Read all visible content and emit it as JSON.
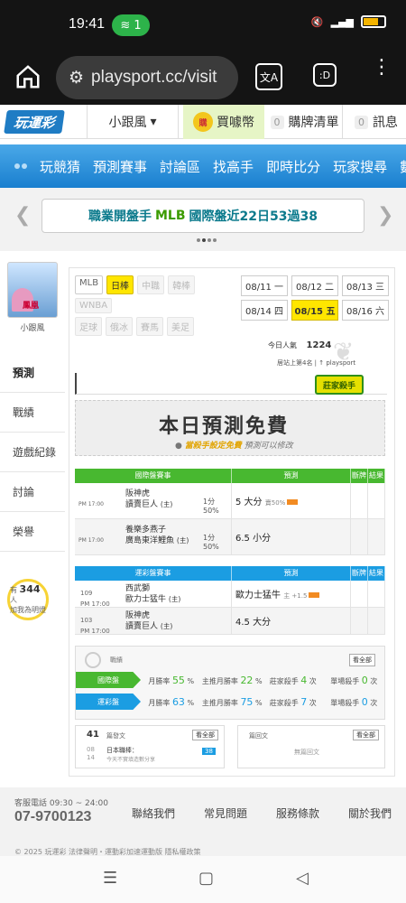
{
  "status": {
    "time": "19:41",
    "notif_count": "1"
  },
  "browser": {
    "url": "playsport.cc/visit",
    "tabs_label": ":D"
  },
  "topnav": {
    "logo": "玩運彩",
    "user": "小跟風",
    "buy_coin_badge": "購",
    "buy": "買噱幣",
    "cart_count": "0",
    "cart": "購牌清單",
    "msg_count": "0",
    "msg": "訊息"
  },
  "bluenav": {
    "items": [
      "玩競猜",
      "預測賽事",
      "討論區",
      "找高手",
      "即時比分",
      "玩家搜尋",
      "數據"
    ]
  },
  "banner": {
    "prefix": "職業開盤手",
    "highlight": "MLB",
    "suffix": "國際盤近22日53過38"
  },
  "sidebar": {
    "avatar_text": "鳳凰",
    "username": "小跟風",
    "menu": [
      "預測",
      "戰績",
      "遊戲紀錄",
      "討論",
      "榮譽"
    ],
    "tracking_prefix": "有",
    "tracking_count": "344",
    "tracking_unit": "人",
    "tracking_suffix": "加我為明燈"
  },
  "leagues": {
    "row1": [
      {
        "label": "MLB",
        "state": "normal"
      },
      {
        "label": "日棒",
        "state": "active"
      },
      {
        "label": "中職",
        "state": "dim"
      },
      {
        "label": "韓棒",
        "state": "dim"
      }
    ],
    "row2": [
      {
        "label": "WNBA",
        "state": "dim"
      }
    ],
    "row3": [
      {
        "label": "足球",
        "state": "dim"
      },
      {
        "label": "俄冰",
        "state": "dim"
      },
      {
        "label": "賽馬",
        "state": "dim"
      },
      {
        "label": "美足",
        "state": "dim"
      }
    ]
  },
  "dates": [
    {
      "date": "08/11",
      "day": "一"
    },
    {
      "date": "08/12",
      "day": "二"
    },
    {
      "date": "08/13",
      "day": "三"
    },
    {
      "date": "08/14",
      "day": "四"
    },
    {
      "date": "08/15",
      "day": "五",
      "active": true
    },
    {
      "date": "08/16",
      "day": "六"
    }
  ],
  "stats": {
    "popular_label": "今日人氣",
    "popular_value": "1224",
    "rank": "居站上第4名 | ↑ playsport",
    "badge": "莊家殺手",
    "badge_sub": "日本國際盤"
  },
  "free": {
    "title": "本日預測免費",
    "note_bold": "當殺手設定免費",
    "note": "預測可以修改"
  },
  "table1": {
    "headers": [
      "國際盤賽事",
      "預測",
      "斷牌",
      "結果"
    ],
    "rows": [
      {
        "time": "PM 17:00",
        "team1": "阪神虎",
        "team2": "讀賣巨人",
        "team2_tag": "(主)",
        "line": "1分",
        "line_pct": "50%",
        "pick": "5 大分",
        "pick_note": "賣50%"
      },
      {
        "time": "PM 17:00",
        "team1": "養樂多燕子",
        "team2": "廣島東洋鯉魚",
        "team2_tag": "(主)",
        "line": "1分",
        "line_pct": "50%",
        "pick": "6.5 小分",
        "pick_note": ""
      }
    ]
  },
  "table2": {
    "headers": [
      "運彩盤賽事",
      "預測",
      "斷牌",
      "結果"
    ],
    "rows": [
      {
        "num": "109",
        "time": "PM 17:00",
        "team1": "西武獅",
        "team2": "歐力士猛牛",
        "team2_tag": "(主)",
        "pick": "歐力士猛牛",
        "pick_note": "主 +1.5"
      },
      {
        "num": "103",
        "time": "PM 17:00",
        "team1": "阪神虎",
        "team2": "讀賣巨人",
        "team2_tag": "(主)",
        "pick": "4.5 大分",
        "pick_note": ""
      }
    ]
  },
  "record": {
    "label": "戰績",
    "view_all": "看全部",
    "rows": [
      {
        "name": "國際盤",
        "color": "#48b830",
        "cells": [
          {
            "label": "月勝率",
            "value": "55",
            "unit": "%"
          },
          {
            "label": "主推月勝率",
            "value": "22",
            "unit": "%"
          },
          {
            "label": "莊家殺手",
            "value": "4",
            "unit": "次"
          },
          {
            "label": "單場殺手",
            "value": "0",
            "unit": "次"
          }
        ]
      },
      {
        "name": "運彩盤",
        "color": "#1b9de2",
        "cells": [
          {
            "label": "月勝率",
            "value": "63",
            "unit": "%"
          },
          {
            "label": "主推月勝率",
            "value": "75",
            "unit": "%"
          },
          {
            "label": "莊家殺手",
            "value": "7",
            "unit": "次"
          },
          {
            "label": "單場殺手",
            "value": "0",
            "unit": "次"
          }
        ]
      }
    ]
  },
  "posts": {
    "count": "41",
    "label": "篇發文",
    "view_all": "看全部",
    "date_m": "08",
    "date_d": "14",
    "title": "日本職棒：",
    "snippet": "今天不實填造數分享",
    "views": "38"
  },
  "replies": {
    "label": "篇回文",
    "view_all": "看全部",
    "empty": "無篇回文"
  },
  "footer": {
    "service": "客服電話 09:30 ~ 24:00",
    "phone": "07-9700123",
    "links": [
      "聯絡我們",
      "常見問題",
      "服務條款",
      "關於我們"
    ],
    "copyright": "© 2025 玩運彩 法律聲明・運動彩加速運動版 隱私權政策"
  }
}
